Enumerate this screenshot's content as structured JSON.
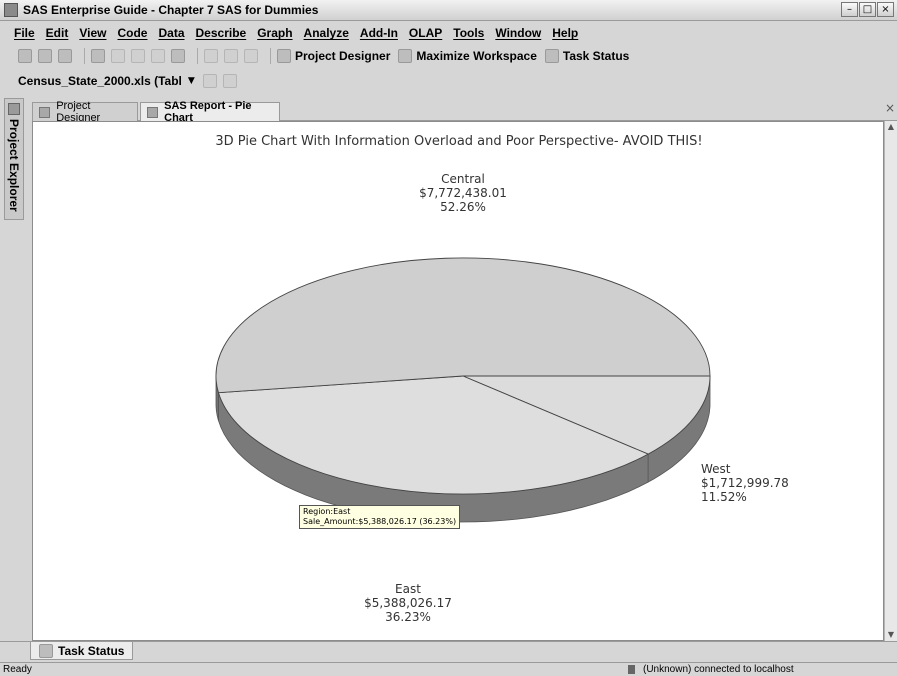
{
  "window": {
    "title": "SAS Enterprise Guide - Chapter 7 SAS for Dummies",
    "buttons": [
      "–",
      "□",
      "×"
    ]
  },
  "menu": [
    "File",
    "Edit",
    "View",
    "Code",
    "Data",
    "Describe",
    "Graph",
    "Analyze",
    "Add-In",
    "OLAP",
    "Tools",
    "Window",
    "Help"
  ],
  "toolbar": {
    "project_designer": "Project Designer",
    "maximize_workspace": "Maximize Workspace",
    "task_status": "Task Status"
  },
  "toolbar2": {
    "dataset": "Census_State_2000.xls (Tabl"
  },
  "sidebar": {
    "label": "Project Explorer"
  },
  "tabs": [
    {
      "label": "Project Designer",
      "active": false
    },
    {
      "label": "SAS Report - Pie Chart",
      "active": true
    }
  ],
  "tab_close": "×",
  "chart_data": {
    "type": "pie",
    "title": "3D Pie Chart With Information Overload and Poor Perspective- AVOID THIS!",
    "slices": [
      {
        "label": "Central",
        "amount": "$7,772,438.01",
        "percent": "52.26%",
        "value": 7772438.01,
        "color": "#cfcfcf"
      },
      {
        "label": "East",
        "amount": "$5,388,026.17",
        "percent": "36.23%",
        "value": 5388026.17,
        "color": "#dedede"
      },
      {
        "label": "West",
        "amount": "$1,712,999.78",
        "percent": "11.52%",
        "value": 1712999.78,
        "color": "#dcdcdc"
      }
    ],
    "tooltip": {
      "line1": "Region:East",
      "line2": "Sale_Amount:$5,388,026.17 (36.23%)"
    }
  },
  "bottom_tab": {
    "label": "Task Status"
  },
  "status": {
    "left": "Ready",
    "right": "(Unknown) connected to localhost"
  }
}
